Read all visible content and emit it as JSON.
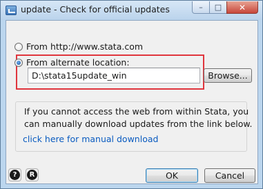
{
  "window": {
    "title": "update - Check for official updates",
    "controls": {
      "minimize": "–",
      "maximize": "□",
      "close": "✕"
    }
  },
  "options": {
    "from_http_label": "From http://www.stata.com",
    "from_http_selected": false,
    "from_alternate_label": "From alternate location:",
    "from_alternate_selected": true,
    "alternate_path_value": "D:\\stata15update_win",
    "browse_label": "Browse..."
  },
  "info": {
    "line1": "If you cannot access the web from within Stata, you",
    "line2": "can manually download updates from the link below.",
    "link_text": "click here for manual download",
    "link_color": "#0a5bc0"
  },
  "footer": {
    "help_glyph": "?",
    "reset_glyph": "R",
    "ok_label": "OK",
    "cancel_label": "Cancel"
  },
  "colors": {
    "highlight_border": "#e0353d",
    "titlebar": "#bcd6ee"
  }
}
